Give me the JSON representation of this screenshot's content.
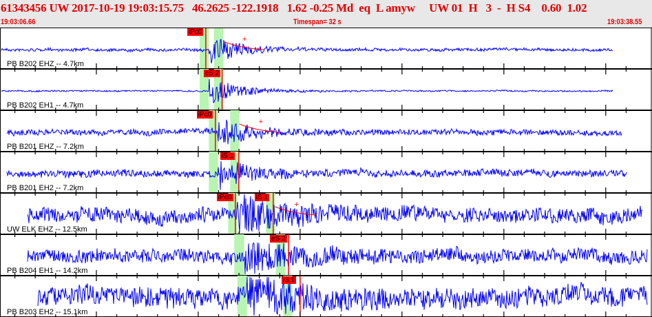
{
  "header": {
    "title": "61343456 UW 2017-10-19 19:03:15.75   46.2625 -122.1918   1.62 -0.25 Md  eq  L amyw     UW 01  H   3  -  H S4    0.60  1.02",
    "start_time": "19:03:06.66",
    "timespan": "Timespan=  32 s",
    "end_time": "19:03:38.55"
  },
  "colors": {
    "trace": "#0000ff",
    "pick": "#ff0000",
    "window": "#b8f5b0",
    "header_text": "#e00000"
  },
  "traces": [
    {
      "label": "PB B202 EHZ -- 4.7km",
      "picks": [
        {
          "label": "iPc0",
          "t": 10.1
        }
      ],
      "windows": [
        [
          9.8,
          10.25
        ],
        [
          10.5,
          10.95
        ]
      ]
    },
    {
      "label": "PB B202 EH1 -- 4.7km",
      "picks": [
        {
          "label": "eS 2",
          "t": 10.9
        }
      ],
      "windows": [
        [
          9.8,
          10.25
        ],
        [
          10.5,
          10.95
        ]
      ]
    },
    {
      "label": "PB B201 EHZ -- 7.2km",
      "picks": [
        {
          "label": "iPc0",
          "t": 10.57
        }
      ],
      "windows": [
        [
          10.25,
          10.7
        ],
        [
          11.3,
          11.75
        ]
      ]
    },
    {
      "label": "PB B201 EH2 -- 7.2km",
      "picks": [
        {
          "label": "iS 1",
          "t": 11.72
        }
      ],
      "windows": [
        [
          10.25,
          10.7
        ],
        [
          11.3,
          11.75
        ]
      ]
    },
    {
      "label": "UW ELK EHZ -- 12.5km",
      "picks": [
        {
          "label": "iPd0",
          "t": 11.55
        },
        {
          "label": "iS 1",
          "t": 13.41
        }
      ],
      "windows": [
        [
          11.2,
          11.65
        ],
        [
          13.05,
          13.5
        ]
      ]
    },
    {
      "label": "PB B204 EH1 -- 14.2km",
      "picks": [
        {
          "label": "eS 2",
          "t": 14.16
        }
      ],
      "windows": [
        [
          11.5,
          11.98
        ],
        [
          13.55,
          14.0
        ]
      ]
    },
    {
      "label": "PB B203 EH2 -- 15.1km",
      "picks": [
        {
          "label": "iS 1",
          "t": 14.73
        }
      ],
      "windows": [
        [
          11.65,
          12.12
        ],
        [
          13.9,
          14.35
        ]
      ]
    }
  ]
}
